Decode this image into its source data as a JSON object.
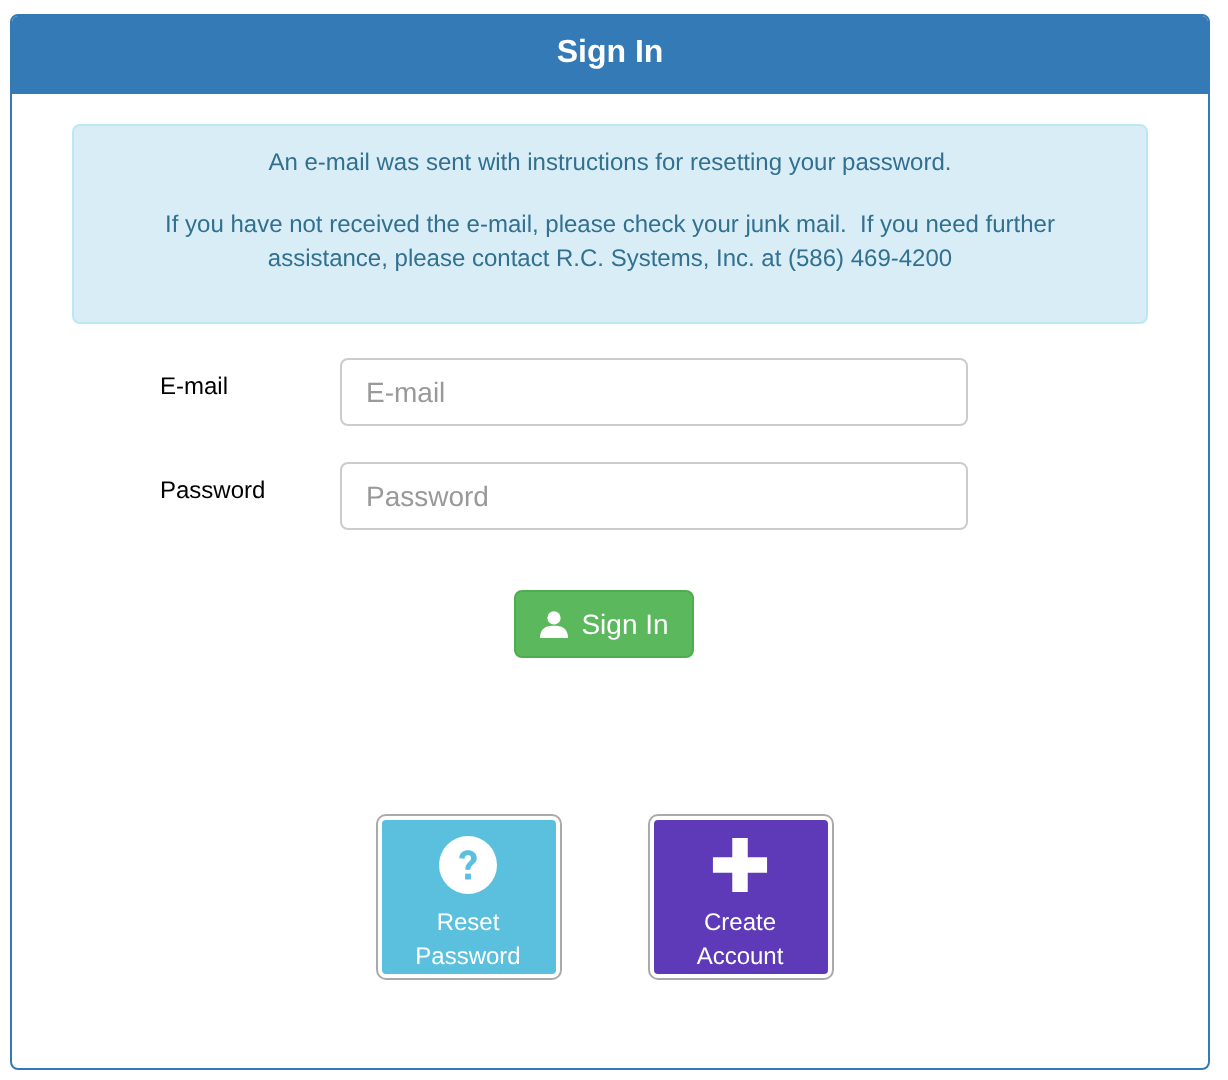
{
  "panel": {
    "title": "Sign In"
  },
  "alert": {
    "paragraphs": [
      "An e-mail was sent with instructions for resetting your password.",
      "If you have not received the e-mail, please check your junk mail.  If you need further assistance, please contact R.C. Systems, Inc. at (586) 469-4200"
    ]
  },
  "fields": [
    {
      "label": "E-mail",
      "placeholder": "E-mail"
    },
    {
      "label": "Password",
      "placeholder": "Password"
    }
  ],
  "sign_in_button": {
    "label": "Sign In"
  },
  "tiles": [
    {
      "label": "Reset Password",
      "kind": "help",
      "color": "#5bc0de"
    },
    {
      "label": "Create Account",
      "kind": "add",
      "color": "#5e3ab8"
    }
  ]
}
